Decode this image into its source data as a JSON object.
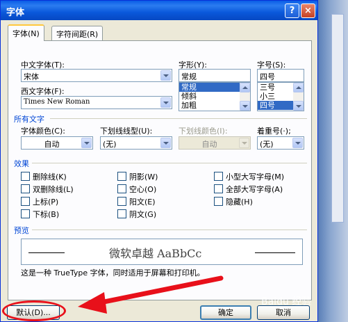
{
  "window": {
    "title": "字体",
    "help_label": "?",
    "close_label": "×"
  },
  "tabs": [
    {
      "label": "字体(N)",
      "active": true
    },
    {
      "label": "字符间距(R)",
      "active": false
    }
  ],
  "labels": {
    "chinese_font": "中文字体(T):",
    "western_font": "西文字体(F):",
    "style": "字形(Y):",
    "size": "字号(S):",
    "all_text": "所有文字",
    "font_color": "字体颜色(C):",
    "underline_type": "下划线线型(U):",
    "underline_color": "下划线颜色(I):",
    "emphasis": "着重号(·);",
    "effects": "效果",
    "preview": "预览"
  },
  "fields": {
    "chinese_font": "宋体",
    "western_font": "Times New Roman",
    "style": "常规",
    "size": "四号",
    "font_color": "自动",
    "underline_type": "(无)",
    "underline_color": "自动",
    "emphasis": "(无)"
  },
  "style_list": [
    "常规",
    "倾斜",
    "加粗"
  ],
  "size_list": [
    "三号",
    "小三",
    "四号"
  ],
  "effects": {
    "col1": [
      "删除线(K)",
      "双删除线(L)",
      "上标(P)",
      "下标(B)"
    ],
    "col2": [
      "阴影(W)",
      "空心(O)",
      "阳文(E)",
      "阴文(G)"
    ],
    "col3": [
      "小型大写字母(M)",
      "全部大写字母(A)",
      "隐藏(H)"
    ]
  },
  "preview": {
    "sample": "微软卓越 AaBbCc",
    "note": "这是一种 TrueType 字体，同时适用于屏幕和打印机。"
  },
  "buttons": {
    "default": "默认(D)...",
    "ok": "确定",
    "cancel": "取消"
  },
  "watermark": "Baidu 经验",
  "colors": {
    "title_blue": "#0a58db",
    "section_blue": "#0046d5",
    "selection": "#316ac5",
    "annotation_red": "#e8101a"
  }
}
